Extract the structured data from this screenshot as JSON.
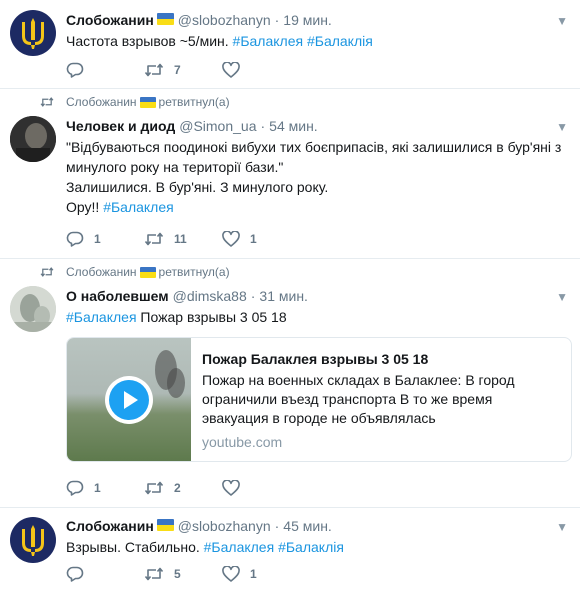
{
  "accent": "#1b95e0",
  "tweets": [
    {
      "name": "Слобожанин",
      "handle": "@slobozhanyn",
      "sep": "·",
      "time": "19 мин.",
      "text_plain": "Частота взрывов ~5/мин. ",
      "hashtags": [
        "#Балаклея",
        "#Балаклія"
      ],
      "reply_count": "",
      "retweet_count": "7",
      "like_count": ""
    },
    {
      "retweeted_by": "Слобожанин",
      "retweeted_label": "ретвитнул(а)",
      "name": "Человек и диод",
      "handle": "@Simon_ua",
      "sep": "·",
      "time": "54 мин.",
      "text_plain": "\"Відбуваються поодинокі вибухи тих боєприпасів, які залишилися в бур'яні з минулого року на території бази.\"\nЗалишилися. В бур'яні. З минулого року.\nОру!! ",
      "hashtag": "#Балаклея",
      "reply_count": "1",
      "retweet_count": "11",
      "like_count": "1"
    },
    {
      "retweeted_by": "Слобожанин",
      "retweeted_label": "ретвитнул(а)",
      "name": "О наболевшем",
      "handle": "@dimska88",
      "sep": "·",
      "time": "31 мин.",
      "hashtag": "#Балаклея",
      "text_after": " Пожар  взрывы 3 05 18",
      "card": {
        "title": "Пожар Балаклея взрывы 3 05 18",
        "description": "Пожар на военных складах в Балаклее: В город ограничили въезд транспорта В то же время эвакуация в городе не объявлялась",
        "domain": "youtube.com"
      },
      "reply_count": "1",
      "retweet_count": "2",
      "like_count": ""
    },
    {
      "name": "Слобожанин",
      "handle": "@slobozhanyn",
      "sep": "·",
      "time": "45 мин.",
      "text_plain": "Взрывы. Стабильно. ",
      "hashtags": [
        "#Балаклея",
        "#Балаклія"
      ],
      "reply_count": "",
      "retweet_count": "5",
      "like_count": "1"
    }
  ]
}
